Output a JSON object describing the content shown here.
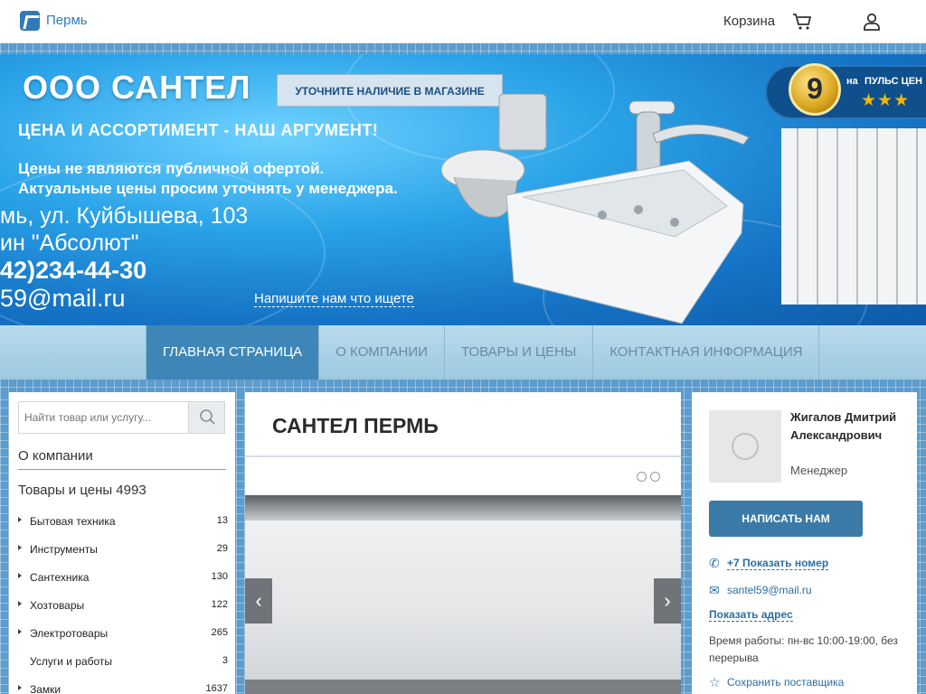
{
  "header": {
    "city": "Пермь",
    "cart_label": "Корзина"
  },
  "banner": {
    "title": "ООО САНТЕЛ",
    "check_button": "УТОЧНИТЕ НАЛИЧИЕ В МАГАЗИНЕ",
    "slogan": "ЦЕНА И АССОРТИМЕНТ - НАШ АРГУМЕНТ!",
    "note_line1": "Цены не являются публичной офертой.",
    "note_line2": "Актуальные цены просим уточнять у менеджера.",
    "address_line1": "мь, ул. Куйбышева, 103",
    "address_line2": "ин \"Абсолют\"",
    "phone": "42)234-44-30",
    "email": "59@mail.ru",
    "write_link": "Напишите нам что ищете",
    "badge_number": "9",
    "badge_on": "на",
    "badge_name": "ПУЛЬС ЦЕН",
    "badge_stars": "★★★"
  },
  "nav": {
    "tabs": [
      {
        "label": "ГЛАВНАЯ СТРАНИЦА"
      },
      {
        "label": "О КОМПАНИИ"
      },
      {
        "label": "ТОВАРЫ И ЦЕНЫ"
      },
      {
        "label": "КОНТАКТНАЯ ИНФОРМАЦИЯ"
      }
    ]
  },
  "sidebar": {
    "search_placeholder": "Найти товар или услугу...",
    "about": "О компании",
    "products": "Товары и цены 4993",
    "categories": [
      {
        "name": "Бытовая техника",
        "count": "13"
      },
      {
        "name": "Инструменты",
        "count": "29"
      },
      {
        "name": "Сантехника",
        "count": "130"
      },
      {
        "name": "Хозтовары",
        "count": "122"
      },
      {
        "name": "Электротовары",
        "count": "265"
      },
      {
        "name": "Услуги и работы",
        "count": "3"
      },
      {
        "name": "Замки",
        "count": "1637"
      }
    ]
  },
  "main": {
    "title": "САНТЕЛ ПЕРМЬ",
    "slider_prev": "‹",
    "slider_next": "›"
  },
  "contact": {
    "manager_name": "Жигалов Дмитрий Александрович",
    "manager_role": "Менеджер",
    "write_button": "НАПИСАТЬ НАМ",
    "phone_link": "+7 Показать номер",
    "email": "santel59@mail.ru",
    "address_link": "Показать адрес",
    "hours": "Время работы: пн-вс 10:00-19:00, без перерыва",
    "save_link": "Сохранить поставщика"
  },
  "colors": {
    "brand": "#2f7ab7",
    "nav_active": "#3f86b8",
    "button": "#3b7aa7"
  }
}
